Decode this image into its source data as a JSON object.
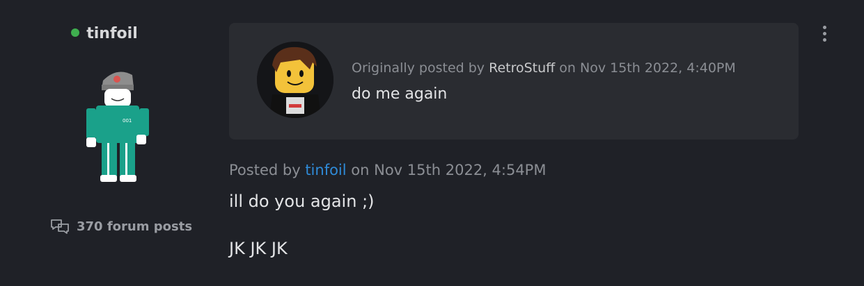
{
  "user": {
    "username": "tinfoil",
    "status": "online",
    "post_count": "370 forum posts"
  },
  "quote": {
    "prefix": "Originally posted by",
    "author": "RetroStuff",
    "date": "on Nov 15th 2022, 4:40PM",
    "text": "do me again"
  },
  "post": {
    "prefix": "Posted by",
    "author": "tinfoil",
    "date": "on Nov 15th 2022, 4:54PM",
    "lines": [
      "ill do you again ;)",
      "JK JK JK"
    ]
  },
  "icons": {
    "online": "online-dot-icon",
    "posts": "chat-bubbles-icon",
    "menu": "more-vertical-icon"
  },
  "colors": {
    "background": "#1f2127",
    "quote_background": "#2a2c31",
    "link": "#2f8bd8",
    "online": "#3fae4f"
  }
}
